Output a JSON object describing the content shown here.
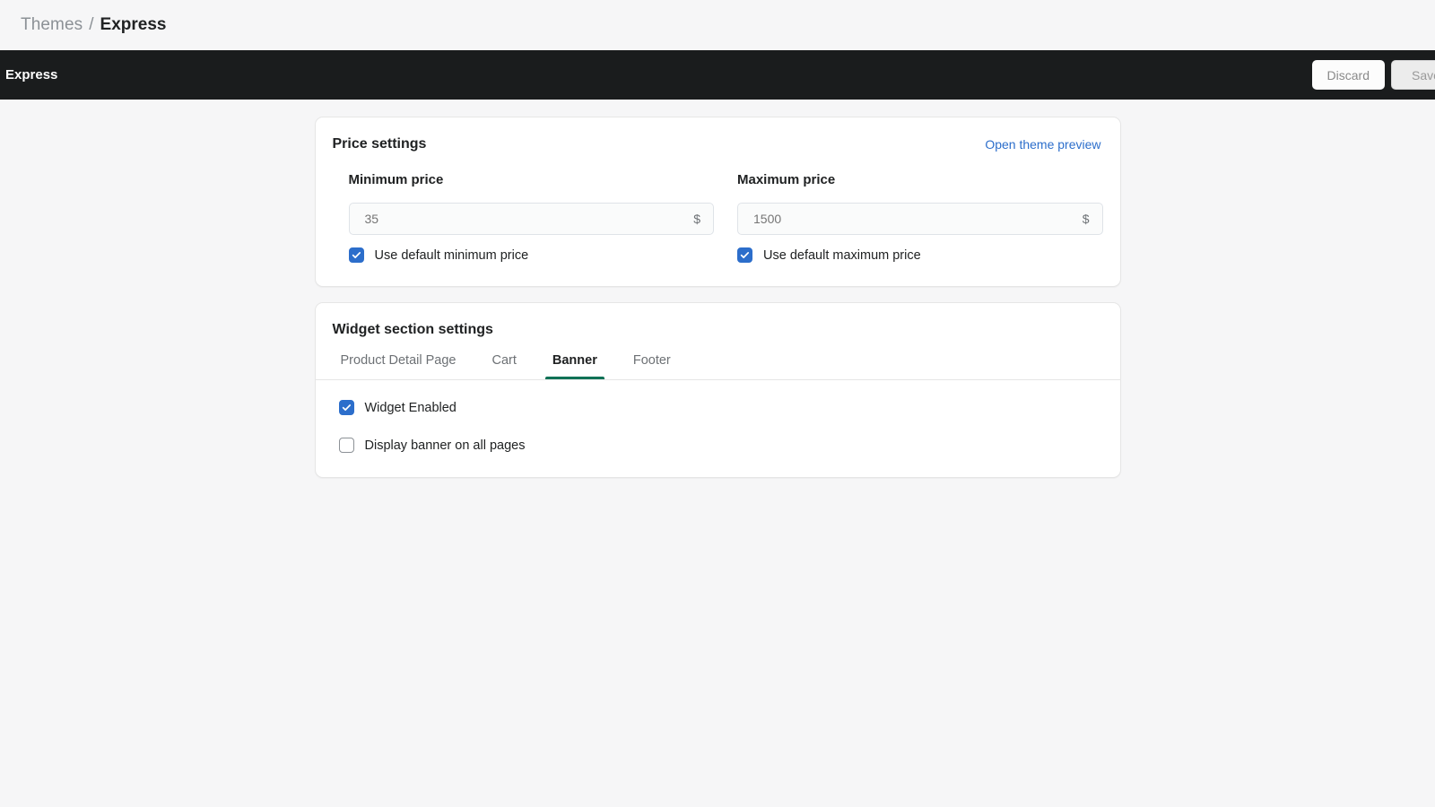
{
  "breadcrumb": {
    "parent": "Themes",
    "separator": "/",
    "current": "Express"
  },
  "context_bar": {
    "title": "Express",
    "discard_label": "Discard",
    "save_label": "Save"
  },
  "price_settings": {
    "title": "Price settings",
    "preview_link": "Open theme preview",
    "minimum": {
      "label": "Minimum price",
      "value": "35",
      "placeholder": "35",
      "suffix": "$",
      "checkbox_label": "Use default minimum price",
      "checked": true
    },
    "maximum": {
      "label": "Maximum price",
      "value": "1500",
      "placeholder": "1500",
      "suffix": "$",
      "checkbox_label": "Use default maximum price",
      "checked": true
    }
  },
  "widget_settings": {
    "title": "Widget section settings",
    "tabs": [
      {
        "label": "Product Detail Page",
        "active": false
      },
      {
        "label": "Cart",
        "active": false
      },
      {
        "label": "Banner",
        "active": true
      },
      {
        "label": "Footer",
        "active": false
      }
    ],
    "options": [
      {
        "label": "Widget Enabled",
        "checked": true
      },
      {
        "label": "Display banner on all pages",
        "checked": false
      }
    ]
  },
  "colors": {
    "accent_blue": "#2c6ecb",
    "active_tab_green": "#0f7156",
    "dark_bar": "#1a1c1d",
    "page_bg": "#f6f6f7"
  }
}
